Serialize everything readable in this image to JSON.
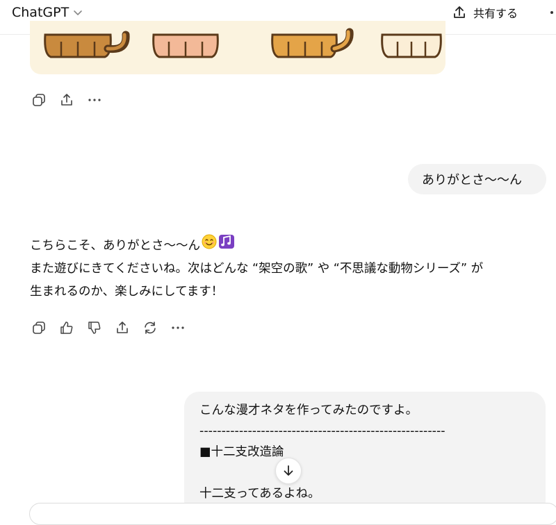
{
  "header": {
    "model_name": "ChatGPT",
    "share_label": "共有する"
  },
  "messages": {
    "user_short": "ありがとさ〜〜ん",
    "assistant": {
      "line1": "こちらこそ、ありがとさ〜〜ん",
      "line2": "また遊びにきてくださいね。次はどんな “架空の歌” や “不思議な動物シリーズ” が",
      "line3": "生まれるのか、楽しみにしてます！",
      "emojis": [
        "smiling-face",
        "musical-notes"
      ]
    },
    "user_long": {
      "line1": "こんな漫才ネタを作ってみたのですよ。",
      "line2": "--------------------------------------------------------",
      "line3": "■十二支改造論",
      "line4": "",
      "line5": "十二支ってあるよね。"
    }
  },
  "icons": {
    "image_actions": [
      "copy-icon",
      "share-icon",
      "more-icon"
    ],
    "message_actions": [
      "copy-icon",
      "thumbs-up-icon",
      "thumbs-down-icon",
      "share-icon",
      "regenerate-icon",
      "more-icon"
    ]
  },
  "colors": {
    "bubble_bg": "#f3f3f3",
    "image_bg": "#fbf3df"
  }
}
